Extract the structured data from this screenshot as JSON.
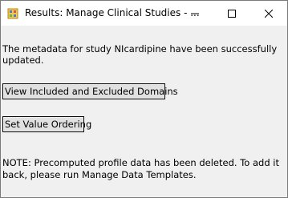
{
  "window": {
    "title": "Results: Manage Clinical Studies - ..."
  },
  "controls": {
    "minimize_icon": "minimize-icon",
    "maximize_icon": "maximize-icon",
    "close_icon": "close-icon"
  },
  "content": {
    "message": "The metadata for study NIcardipine have been successfully updated.",
    "buttons": {
      "view_domains_label": "View Included and Excluded Domains",
      "value_ordering_label": "Set Value Ordering"
    },
    "note": "NOTE: Precomputed profile data has been deleted. To add it back, please run Manage Data Templates."
  }
}
